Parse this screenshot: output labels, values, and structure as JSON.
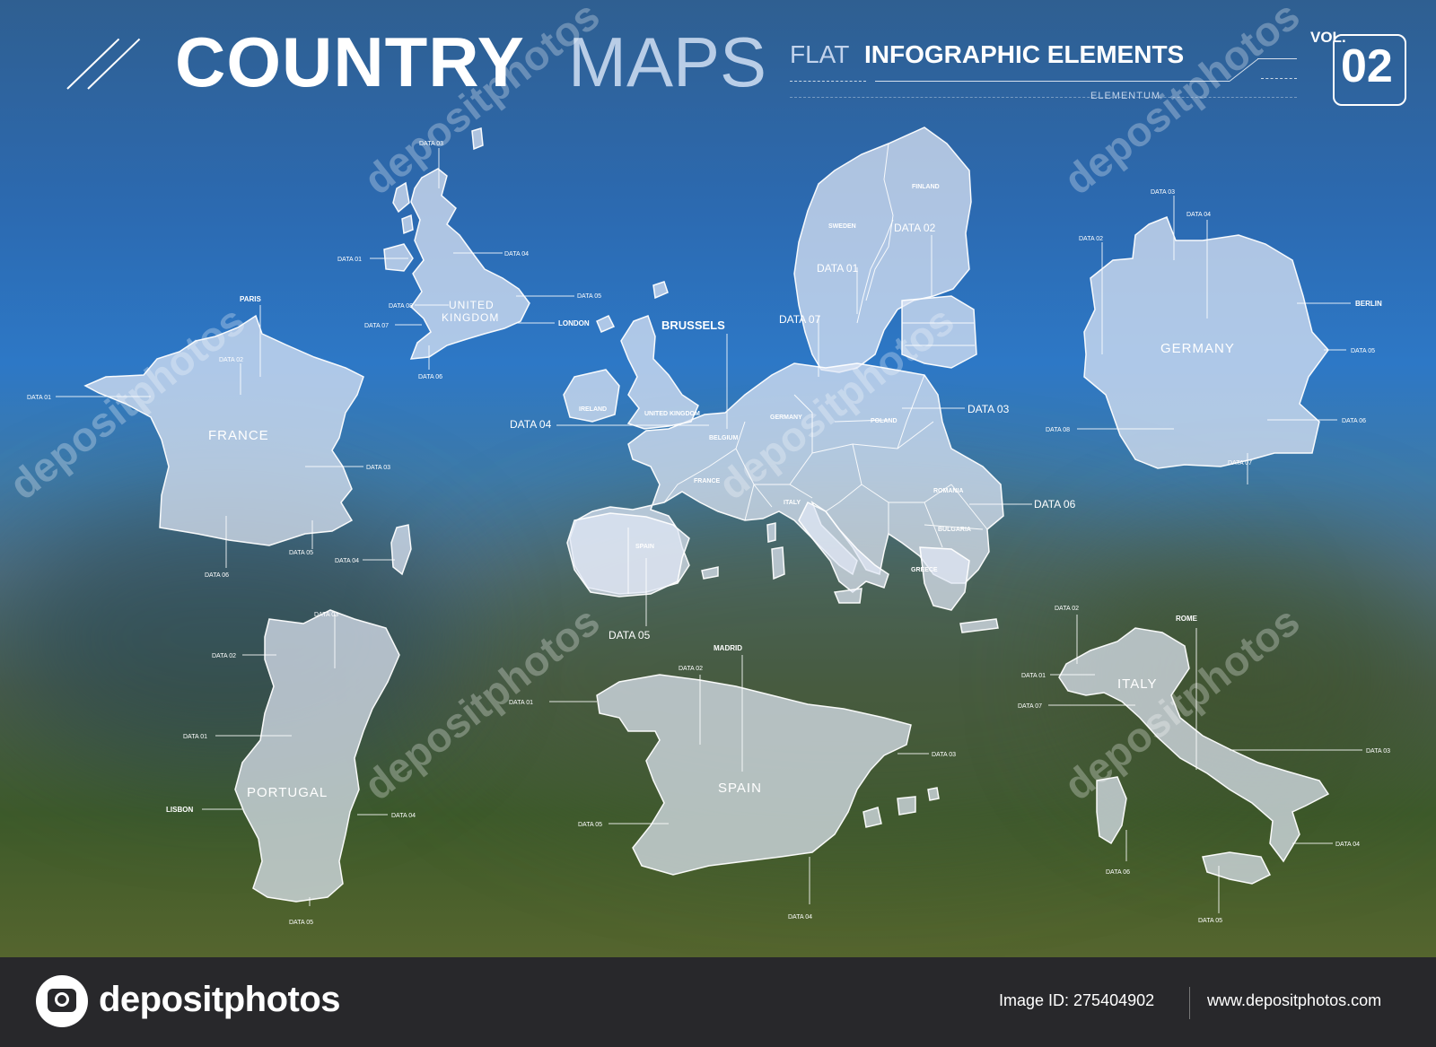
{
  "header": {
    "title_bold": "COUNTRY",
    "title_light": "MAPS",
    "subtitle_flat": "FLAT",
    "subtitle_bold": "INFOGRAPHIC ELEMENTS",
    "brand_small": "ELEMENTUM",
    "vol_label": "VOL.",
    "vol_number": "02"
  },
  "watermark": {
    "text": "depositphotos"
  },
  "europe_map": {
    "countries": [
      "FINLAND",
      "SWEDEN",
      "IRELAND",
      "UNITED KINGDOM",
      "BELGIUM",
      "GERMANY",
      "POLAND",
      "FRANCE",
      "ITALY",
      "ROMANIA",
      "BULGARIA",
      "SPAIN",
      "GREECE"
    ],
    "capital": "BRUSSELS",
    "markers": [
      "DATA 01",
      "DATA 02",
      "DATA 03",
      "DATA 04",
      "DATA 05",
      "DATA 06",
      "DATA 07"
    ]
  },
  "uk_map": {
    "name_line1": "UNITED",
    "name_line2": "KINGDOM",
    "capital": "LONDON",
    "markers": [
      "DATA 01",
      "DATA 03",
      "DATA 04",
      "DATA 05",
      "DATA 06",
      "DATA 07",
      "DATA 08"
    ]
  },
  "france_map": {
    "name": "FRANCE",
    "capital": "PARIS",
    "markers": [
      "DATA 01",
      "DATA 02",
      "DATA 03",
      "DATA 04",
      "DATA 05",
      "DATA 06"
    ]
  },
  "germany_map": {
    "name": "GERMANY",
    "capital": "BERLIN",
    "markers": [
      "DATA 02",
      "DATA 03",
      "DATA 04",
      "DATA 05",
      "DATA 06",
      "DATA 07",
      "DATA 08"
    ]
  },
  "portugal_map": {
    "name": "PORTUGAL",
    "capital": "LISBON",
    "markers": [
      "DATA 01",
      "DATA 02",
      "DATA 03",
      "DATA 04",
      "DATA 05"
    ]
  },
  "spain_map": {
    "name": "SPAIN",
    "capital": "MADRID",
    "markers": [
      "DATA 01",
      "DATA 02",
      "DATA 03",
      "DATA 04",
      "DATA 05"
    ]
  },
  "italy_map": {
    "name": "ITALY",
    "capital": "ROME",
    "markers": [
      "DATA 01",
      "DATA 02",
      "DATA 03",
      "DATA 04",
      "DATA 05",
      "DATA 06",
      "DATA 07"
    ]
  },
  "footer": {
    "logo_text": "depositphotos",
    "image_id": "Image ID: 275404902",
    "url": "www.depositphotos.com"
  }
}
